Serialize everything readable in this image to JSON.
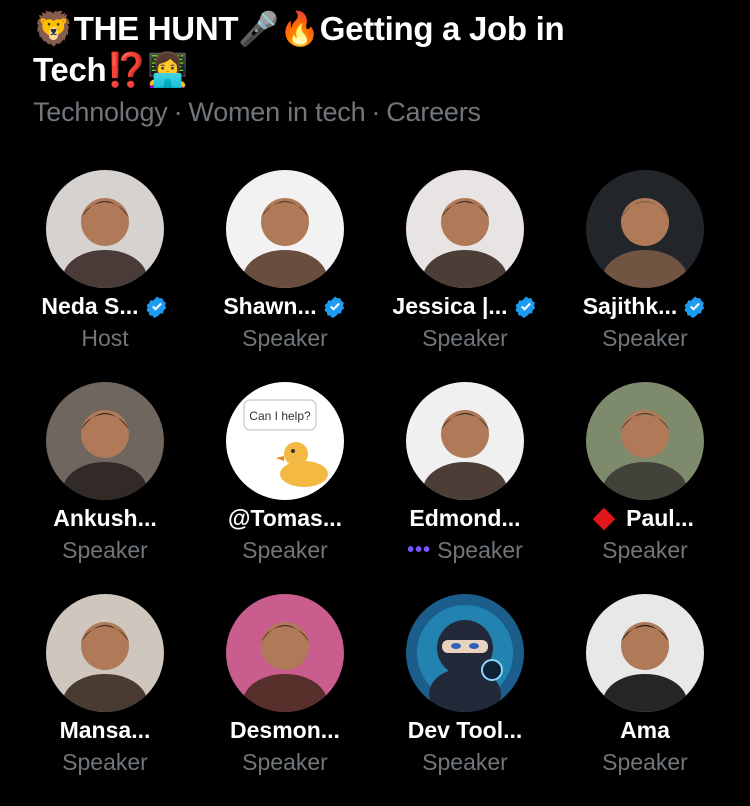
{
  "space": {
    "title_line1": "🦁THE HUNT🎤🔥Getting a Job in",
    "title_line2": "Tech⁉️👩‍💻",
    "topics": [
      "Technology",
      "Women in tech",
      "Careers"
    ]
  },
  "participants": [
    {
      "name": "Neda S...",
      "role": "Host",
      "verified": true,
      "avatar_bg": "#d6d2cf",
      "avatar_fg": "#3a2a26",
      "icon": "person"
    },
    {
      "name": "Shawn...",
      "role": "Speaker",
      "verified": true,
      "avatar_bg": "#f2f2f2",
      "avatar_fg": "#5a3b2a",
      "icon": "person"
    },
    {
      "name": "Jessica |...",
      "role": "Speaker",
      "verified": true,
      "avatar_bg": "#e9e4e4",
      "avatar_fg": "#3b2a22",
      "icon": "person"
    },
    {
      "name": "Sajithk...",
      "role": "Speaker",
      "verified": true,
      "avatar_bg": "#22262b",
      "avatar_fg": "#7a5a44",
      "icon": "person"
    },
    {
      "name": "Ankush...",
      "role": "Speaker",
      "verified": false,
      "avatar_bg": "#6f6660",
      "avatar_fg": "#2b2320",
      "icon": "person"
    },
    {
      "name": "@Tomas...",
      "role": "Speaker",
      "verified": false,
      "avatar_bg": "#ffffff",
      "avatar_fg": "#f4b942",
      "icon": "duck",
      "bubble_text": "Can I help?"
    },
    {
      "name": "Edmond...",
      "role": "Speaker",
      "verified": false,
      "avatar_bg": "#f0f0f0",
      "avatar_fg": "#3a2a22",
      "icon": "person",
      "speaking": true
    },
    {
      "name": "Paul...",
      "role": "Speaker",
      "verified": false,
      "avatar_bg": "#7d8a6c",
      "avatar_fg": "#3c3a36",
      "icon": "person",
      "badge": "red-diamond"
    },
    {
      "name": "Mansa...",
      "role": "Speaker",
      "verified": false,
      "avatar_bg": "#cfc6bd",
      "avatar_fg": "#3a2a22",
      "icon": "person"
    },
    {
      "name": "Desmon...",
      "role": "Speaker",
      "verified": false,
      "avatar_bg": "#c85d8e",
      "avatar_fg": "#4a2a20",
      "icon": "person"
    },
    {
      "name": "Dev Tool...",
      "role": "Speaker",
      "verified": false,
      "avatar_bg": "#1b5e8c",
      "avatar_fg": "#222a3a",
      "icon": "ninja"
    },
    {
      "name": "Ama",
      "role": "Speaker",
      "verified": false,
      "avatar_bg": "#e8e8e8",
      "avatar_fg": "#111111",
      "icon": "person"
    }
  ],
  "colors": {
    "background": "#000000",
    "muted_text": "#71767b",
    "verified_blue": "#1d9bf0",
    "speaking_purple": "#7856ff"
  }
}
